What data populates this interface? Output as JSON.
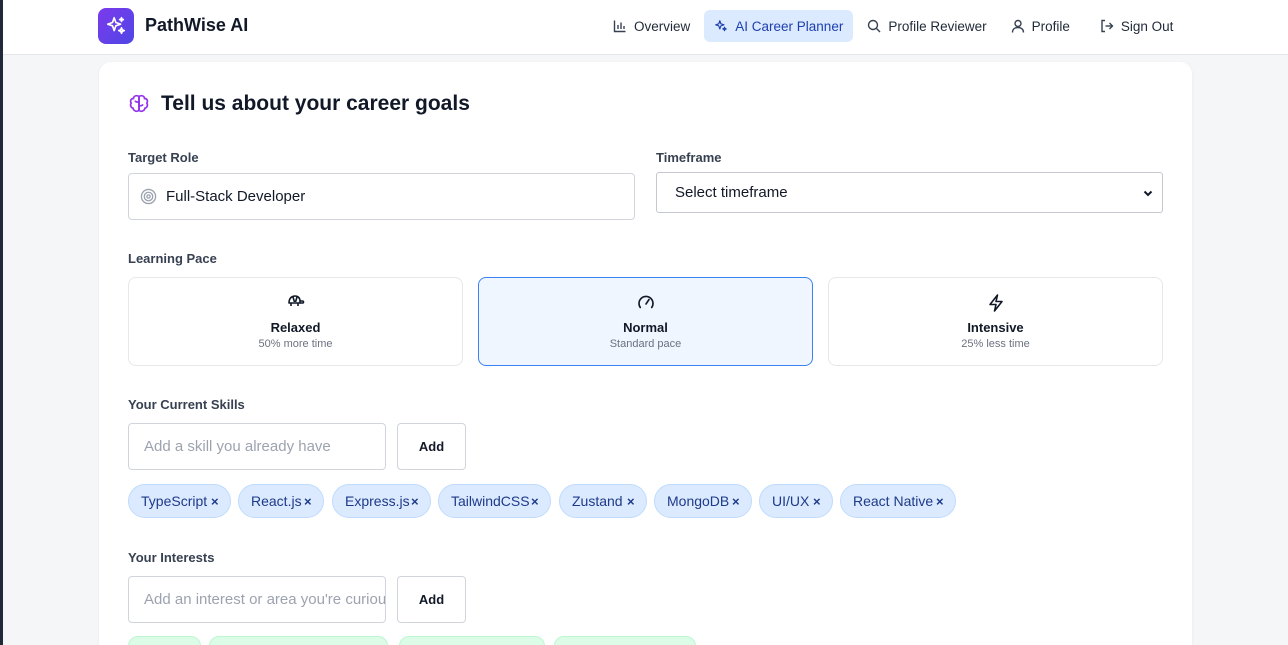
{
  "header": {
    "brand": "PathWise AI",
    "nav": [
      {
        "label": "Overview",
        "icon": "bar-chart-icon",
        "active": false
      },
      {
        "label": "AI Career Planner",
        "icon": "sparkles-icon",
        "active": true
      },
      {
        "label": "Profile Reviewer",
        "icon": "search-icon",
        "active": false
      },
      {
        "label": "Profile",
        "icon": "user-icon",
        "active": false
      },
      {
        "label": "Sign Out",
        "icon": "sign-out-icon",
        "active": false
      }
    ]
  },
  "form": {
    "title": "Tell us about your career goals",
    "target_role_label": "Target Role",
    "target_role_value": "Full-Stack Developer",
    "timeframe_label": "Timeframe",
    "timeframe_value": "Select timeframe",
    "pace_label": "Learning Pace",
    "paces": [
      {
        "name": "Relaxed",
        "sub": "50% more time",
        "icon": "turtle-icon",
        "selected": false
      },
      {
        "name": "Normal",
        "sub": "Standard pace",
        "icon": "gauge-icon",
        "selected": true
      },
      {
        "name": "Intensive",
        "sub": "25% less time",
        "icon": "lightning-icon",
        "selected": false
      }
    ],
    "skills_label": "Your Current Skills",
    "skills_placeholder": "Add a skill you already have",
    "add_label": "Add",
    "skills": [
      "TypeScript",
      "React.js",
      "Express.js",
      "TailwindCSS",
      "Zustand",
      "MongoDB",
      "UI/UX",
      "React Native"
    ],
    "interests_label": "Your Interests",
    "interests_placeholder": "Add an interest or area you're curious about"
  },
  "colors": {
    "accent": "#2563eb",
    "brand_gradient_start": "#7c3aed",
    "brand_gradient_end": "#4f46e5",
    "skill_chip_bg": "#dbeafe",
    "interest_chip_bg": "#dcfce7"
  }
}
